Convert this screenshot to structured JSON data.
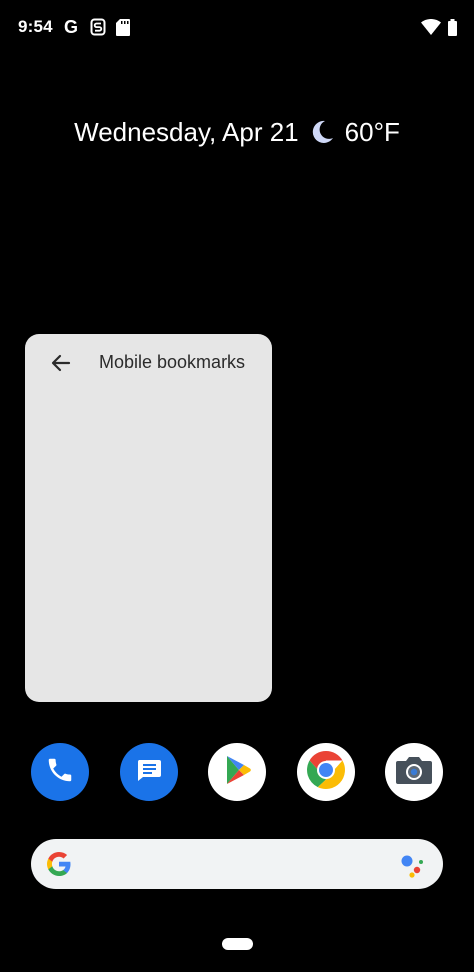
{
  "status_bar": {
    "time": "9:54",
    "notification_icons": [
      "google-g-icon",
      "s-notification-icon",
      "sd-card-icon"
    ],
    "system_icons": [
      "wifi-icon",
      "battery-icon"
    ],
    "g_glyph": "G"
  },
  "glance": {
    "date": "Wednesday, Apr 21",
    "weather_icon": "moon-icon",
    "temperature": "60°F"
  },
  "bookmarks_widget": {
    "title": "Mobile bookmarks",
    "back_icon": "arrow-back-icon",
    "background": "#e6e6e6"
  },
  "dock": {
    "apps": [
      {
        "name": "Phone",
        "icon": "phone-icon",
        "color": "#1a73e8"
      },
      {
        "name": "Messages",
        "icon": "messages-icon",
        "color": "#1a73e8"
      },
      {
        "name": "Play Store",
        "icon": "play-store-icon",
        "color": "#ffffff"
      },
      {
        "name": "Chrome",
        "icon": "chrome-icon",
        "color": "#ffffff"
      },
      {
        "name": "Camera",
        "icon": "camera-icon",
        "color": "#ffffff"
      }
    ]
  },
  "search_bar": {
    "left_icon": "google-g-icon",
    "right_icon": "assistant-icon"
  },
  "colors": {
    "background": "#000000",
    "accent_blue": "#1a73e8",
    "google_blue": "#4285f4",
    "google_red": "#ea4335",
    "google_yellow": "#fbbc05",
    "google_green": "#34a853"
  }
}
